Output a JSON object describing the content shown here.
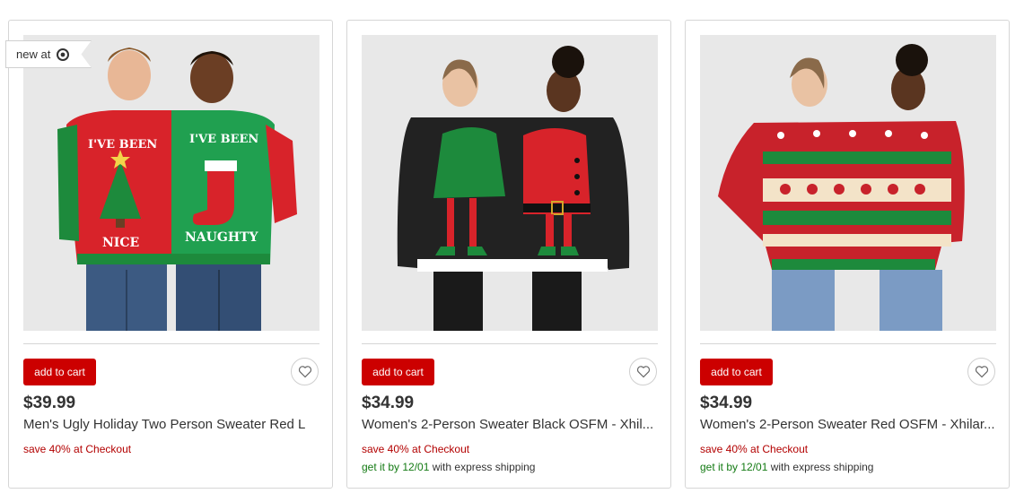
{
  "badge": {
    "text": "new at",
    "icon": "target-bullseye-icon"
  },
  "products": [
    {
      "add_to_cart": "add to cart",
      "price": "$39.99",
      "title": "Men's Ugly Holiday Two Person Sweater Red L",
      "promo": "save 40% at Checkout",
      "sweater_left_text": "I'VE BEEN",
      "sweater_left_text2": "NICE",
      "sweater_right_text": "I'VE BEEN",
      "sweater_right_text2": "NAUGHTY"
    },
    {
      "add_to_cart": "add to cart",
      "price": "$34.99",
      "title": "Women's 2-Person Sweater Black OSFM - Xhil...",
      "promo": "save 40% at Checkout",
      "ship_date": "get it by 12/01",
      "ship_method": " with express shipping"
    },
    {
      "add_to_cart": "add to cart",
      "price": "$34.99",
      "title": "Women's 2-Person Sweater Red OSFM - Xhilar...",
      "promo": "save 40% at Checkout",
      "ship_date": "get it by 12/01",
      "ship_method": " with express shipping"
    }
  ],
  "colors": {
    "cart_button": "#cc0000",
    "promo": "#b30000",
    "ship_date": "#137a13"
  }
}
